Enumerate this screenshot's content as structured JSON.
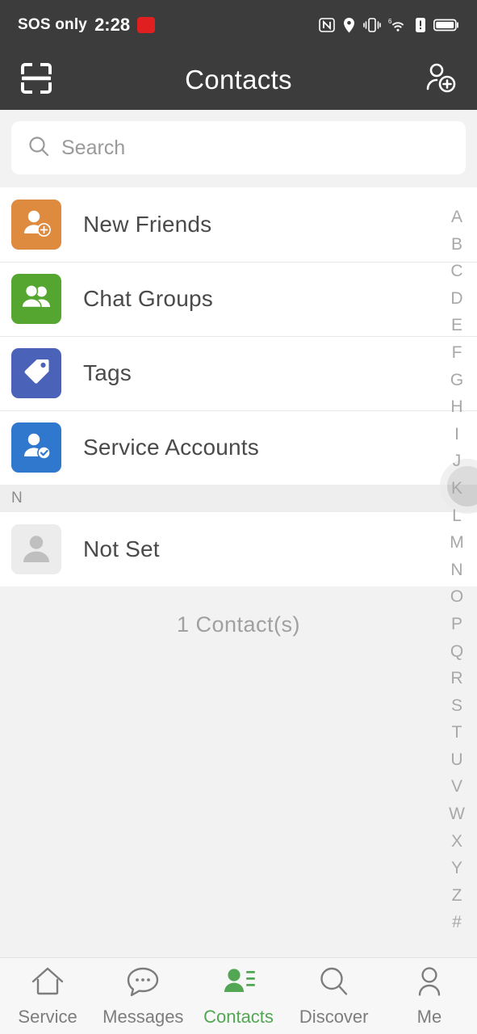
{
  "statusbar": {
    "carrier": "SOS only",
    "time": "2:28",
    "badge_label": "",
    "icons": [
      "nfc-icon",
      "location-icon",
      "vibrate-icon",
      "wifi-6-icon",
      "alert-icon",
      "battery-icon"
    ]
  },
  "header": {
    "title": "Contacts",
    "scan_icon": "scan-qr-icon",
    "add_contact_icon": "add-contact-icon",
    "background_color": "#3c3c3c"
  },
  "search": {
    "placeholder": "Search",
    "icon": "search-icon"
  },
  "list": {
    "items": [
      {
        "label": "New Friends",
        "icon": "person-add-icon",
        "color": "#de8a3f"
      },
      {
        "label": "Chat Groups",
        "icon": "group-icon",
        "color": "#55a630"
      },
      {
        "label": "Tags",
        "icon": "tag-icon",
        "color": "#4a62b8"
      },
      {
        "label": "Service Accounts",
        "icon": "verified-user-icon",
        "color": "#3077ce"
      }
    ],
    "section_header": "N",
    "contacts": [
      {
        "label": "Not Set",
        "icon": "default-avatar-icon",
        "color": "#ececec"
      }
    ],
    "count_text": "1  Contact(s)"
  },
  "alpha_index": {
    "letters": [
      "A",
      "B",
      "C",
      "D",
      "E",
      "F",
      "G",
      "H",
      "I",
      "J",
      "K",
      "L",
      "M",
      "N",
      "O",
      "P",
      "Q",
      "R",
      "S",
      "T",
      "U",
      "V",
      "W",
      "X",
      "Y",
      "Z",
      "#"
    ]
  },
  "float_widget": {
    "name": "assistive-touch-ball"
  },
  "bottom_nav": {
    "active_color": "#53a653",
    "inactive_color": "#7d7d7d",
    "items": [
      {
        "label": "Service",
        "icon": "home-icon",
        "active": false
      },
      {
        "label": "Messages",
        "icon": "chat-icon",
        "active": false
      },
      {
        "label": "Contacts",
        "icon": "contacts-icon",
        "active": true
      },
      {
        "label": "Discover",
        "icon": "search-icon",
        "active": false
      },
      {
        "label": "Me",
        "icon": "person-icon",
        "active": false
      }
    ]
  }
}
